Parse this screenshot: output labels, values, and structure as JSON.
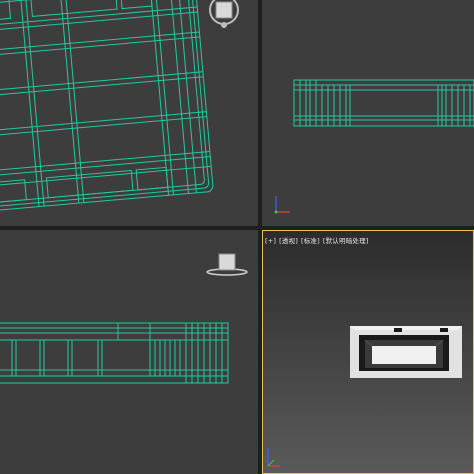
{
  "viewports": {
    "top": {
      "view": "Top",
      "shading": "Wireframe",
      "active": false
    },
    "front": {
      "view": "Front",
      "shading": "Wireframe",
      "active": false
    },
    "left": {
      "view": "Left",
      "shading": "Wireframe",
      "active": false
    },
    "perspective": {
      "active": true,
      "label": {
        "plus": "[+]",
        "view": "[透视]",
        "mode": "[标准]",
        "shading": "[默认明暗处理]"
      }
    }
  },
  "colors": {
    "wireframe": "#22c9a0",
    "viewport_bg": "#3d3d3d",
    "active_border": "#e5c15a",
    "axis_x": "#e04040",
    "axis_y": "#40c040",
    "axis_z": "#4060ff"
  },
  "icons": [
    "viewcube-icon",
    "axis-tripod-icon"
  ]
}
